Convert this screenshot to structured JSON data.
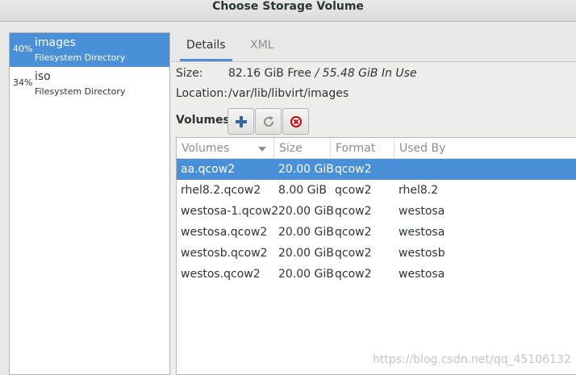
{
  "window": {
    "title": "Choose Storage Volume"
  },
  "pools": [
    {
      "percent": "40%",
      "name": "images",
      "type": "Filesystem Directory",
      "selected": true
    },
    {
      "percent": "34%",
      "name": "iso",
      "type": "Filesystem Directory",
      "selected": false
    }
  ],
  "tabs": [
    {
      "label": "Details",
      "active": true
    },
    {
      "label": "XML",
      "active": false
    }
  ],
  "details": {
    "size_label": "Size:",
    "free": "82.16 GiB Free",
    "separator": " / ",
    "in_use": "55.48 GiB In Use",
    "location_label": "Location:",
    "location": "/var/lib/libvirt/images",
    "volumes_label": "Volumes"
  },
  "toolbar": {
    "add_icon": "plus-icon",
    "refresh_icon": "refresh-icon",
    "delete_icon": "delete-icon",
    "colors": {
      "add": "#3465a4",
      "delete": "#cc0000"
    }
  },
  "table": {
    "columns": [
      "Volumes",
      "Size",
      "Format",
      "Used By"
    ],
    "sort_icon": "sort-down-icon",
    "rows": [
      {
        "name": "aa.qcow2",
        "size": "20.00 GiB",
        "format": "qcow2",
        "used_by": "",
        "selected": true
      },
      {
        "name": "rhel8.2.qcow2",
        "size": "8.00 GiB",
        "format": "qcow2",
        "used_by": "rhel8.2",
        "selected": false
      },
      {
        "name": "westosa-1.qcow2",
        "size": "20.00 GiB",
        "format": "qcow2",
        "used_by": "westosa",
        "selected": false
      },
      {
        "name": "westosa.qcow2",
        "size": "20.00 GiB",
        "format": "qcow2",
        "used_by": "westosa",
        "selected": false
      },
      {
        "name": "westosb.qcow2",
        "size": "20.00 GiB",
        "format": "qcow2",
        "used_by": "westosb",
        "selected": false
      },
      {
        "name": "westos.qcow2",
        "size": "20.00 GiB",
        "format": "qcow2",
        "used_by": "westosa",
        "selected": false
      }
    ]
  },
  "watermark": "https://blog.csdn.net/qq_45106132",
  "colors": {
    "selection": "#4a90d9"
  }
}
